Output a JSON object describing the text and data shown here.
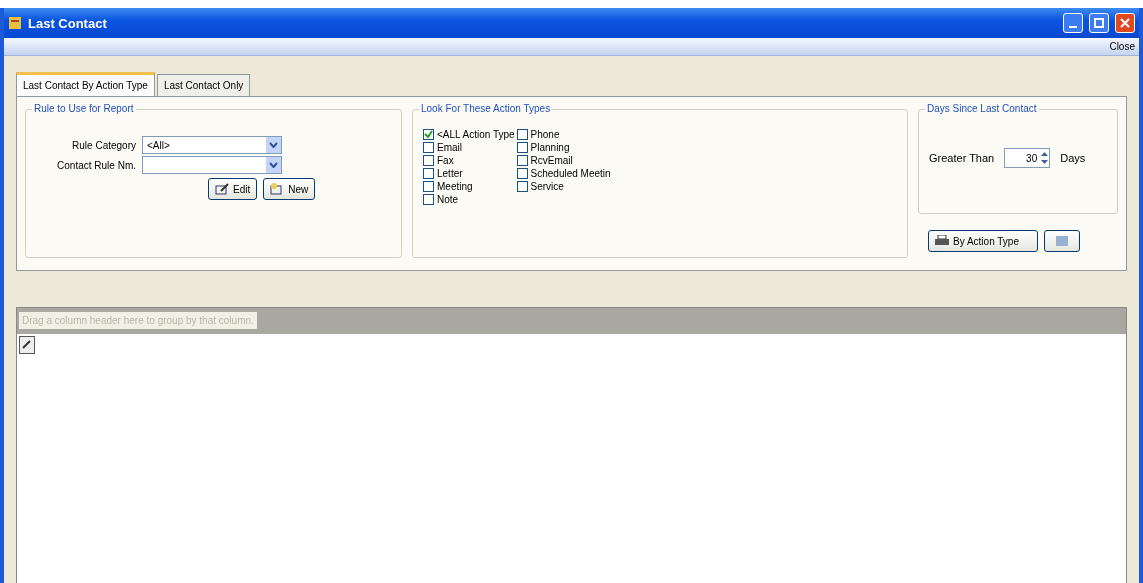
{
  "window": {
    "title": "Last Contact"
  },
  "toolbar": {
    "close": "Close"
  },
  "tabs": [
    {
      "label": "Last Contact By Action Type",
      "selected": true
    },
    {
      "label": "Last Contact Only",
      "selected": false
    }
  ],
  "rule_group": {
    "title": "Rule to Use for Report",
    "fields": [
      {
        "label": "Rule Category",
        "value": "<All>"
      },
      {
        "label": "Contact Rule Nm."
      }
    ],
    "buttons": [
      "Edit",
      "New"
    ]
  },
  "action_types": {
    "title": "Look For These Action Types",
    "columns": [
      [
        {
          "label": "<ALL Action Type",
          "checked": true
        },
        {
          "label": "Email",
          "checked": false
        },
        {
          "label": "Fax",
          "checked": false
        },
        {
          "label": "Letter",
          "checked": false
        },
        {
          "label": "Meeting",
          "checked": false
        },
        {
          "label": "Note",
          "checked": false
        }
      ],
      [
        {
          "label": "Phone",
          "checked": false
        },
        {
          "label": "Planning",
          "checked": false
        },
        {
          "label": "RcvEmail",
          "checked": false
        },
        {
          "label": "Scheduled Meetin",
          "checked": false
        },
        {
          "label": "Service",
          "checked": false
        }
      ]
    ]
  },
  "days_group": {
    "title": "Days Since Last Contact",
    "label": "Greater Than",
    "value": "30",
    "unit": "Days"
  },
  "report_button": "By Action Type",
  "grid": {
    "group_hint": "Drag a column header here to group by that column."
  }
}
